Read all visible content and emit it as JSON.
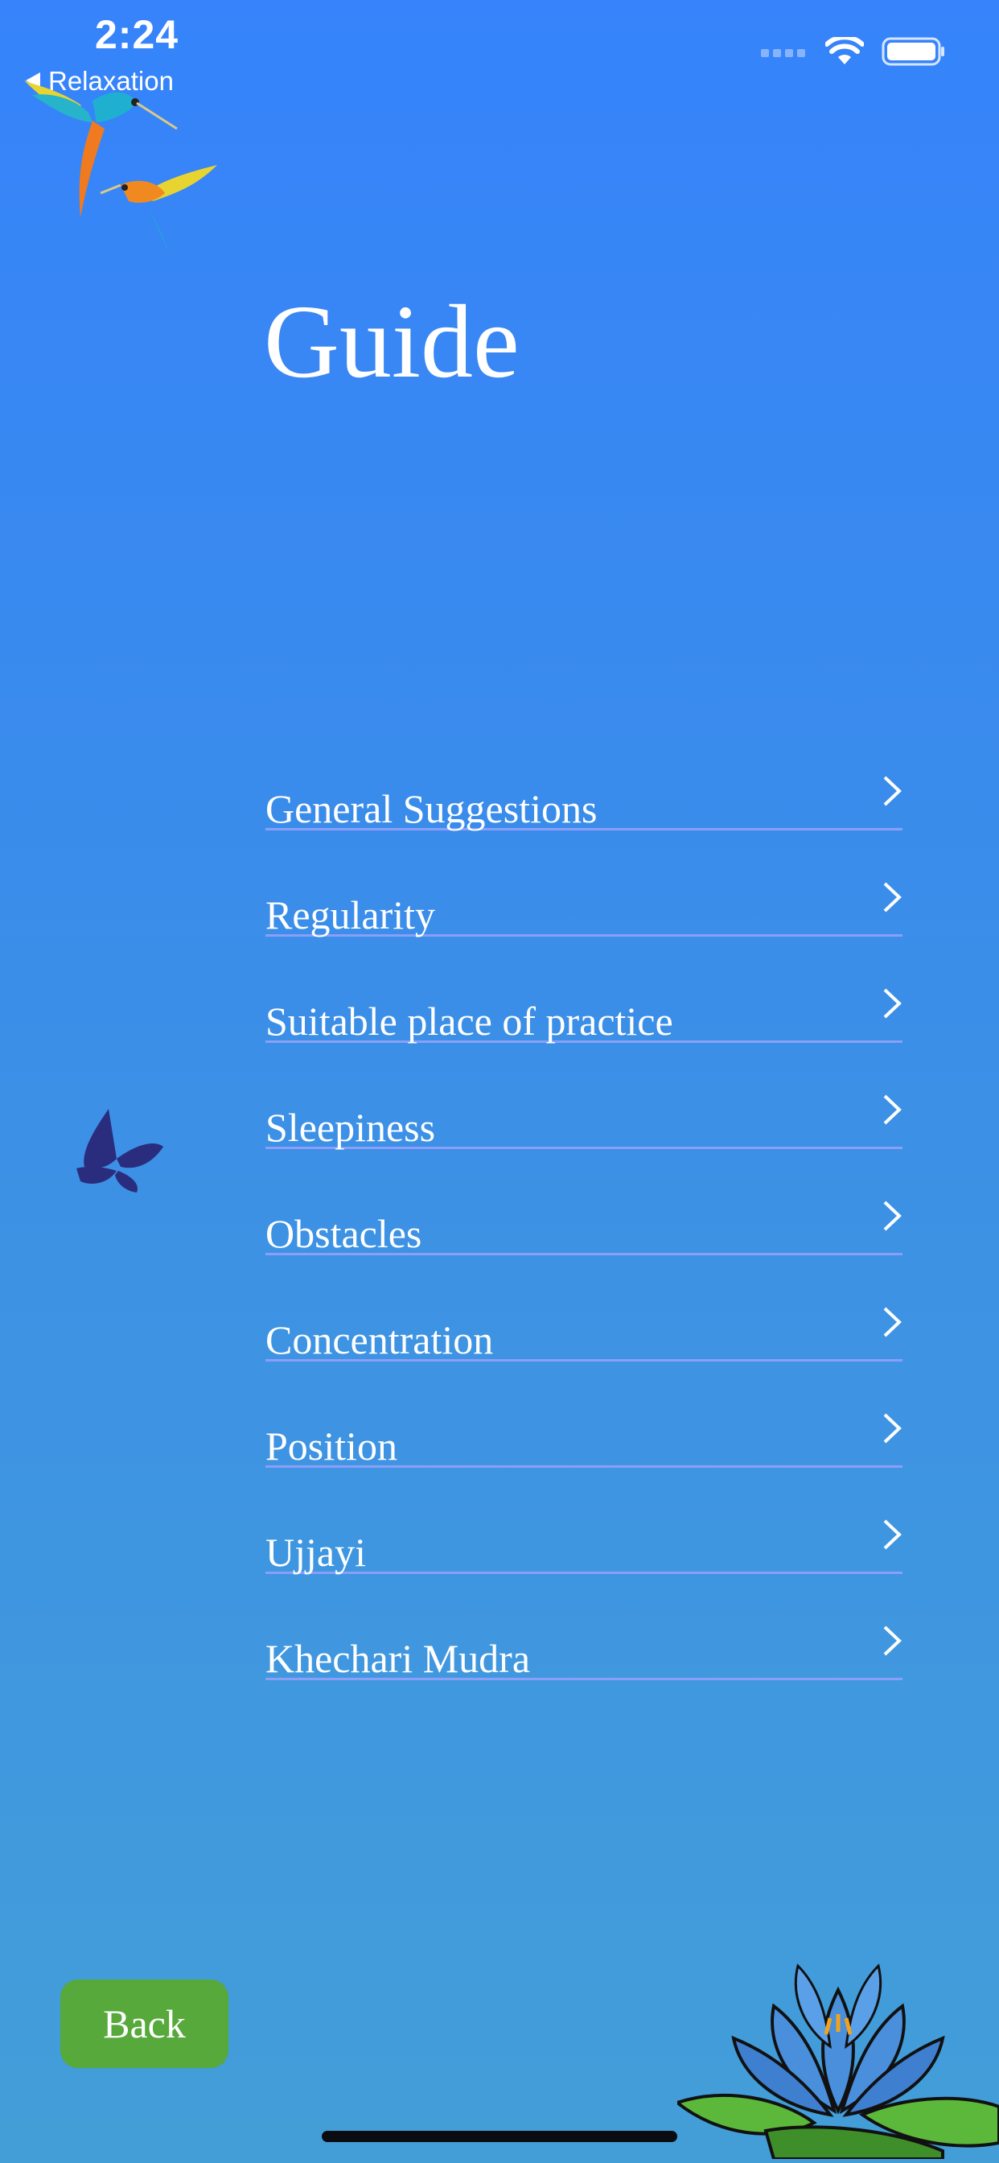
{
  "status_bar": {
    "time": "2:24",
    "back_app": "Relaxation"
  },
  "page": {
    "title": "Guide"
  },
  "menu": {
    "items": [
      {
        "label": "General Suggestions"
      },
      {
        "label": "Regularity"
      },
      {
        "label": "Suitable place of practice"
      },
      {
        "label": "Sleepiness"
      },
      {
        "label": "Obstacles"
      },
      {
        "label": "Concentration"
      },
      {
        "label": "Position"
      },
      {
        "label": "Ujjayi"
      },
      {
        "label": "Khechari Mudra"
      }
    ]
  },
  "footer": {
    "back_label": "Back"
  },
  "colors": {
    "background_top": "#3683fb",
    "background_bottom": "#439ed8",
    "divider": "#8c9ff8",
    "back_button": "#56a93a",
    "text": "#ffffff"
  },
  "icons": {
    "chevron": "chevron-right-icon",
    "decor": [
      "hummingbird-icon",
      "butterfly-icon",
      "lotus-icon"
    ]
  }
}
